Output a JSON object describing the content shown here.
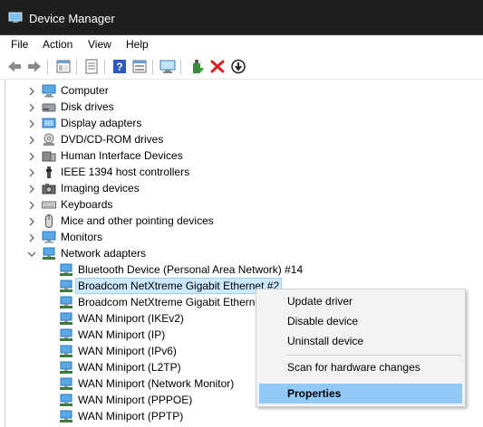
{
  "window": {
    "title": "Device Manager"
  },
  "menu": [
    "File",
    "Action",
    "View",
    "Help"
  ],
  "toolbar": {
    "buttons": [
      "back-icon",
      "forward-icon",
      "show-hide-tree-icon",
      "properties-icon",
      "help-icon",
      "view-icon",
      "scan-hardware-icon",
      "enable-device-icon",
      "uninstall-icon",
      "update-driver-icon"
    ]
  },
  "tree": {
    "categories": [
      {
        "label": "Computer",
        "icon": "computer-icon",
        "expanded": false
      },
      {
        "label": "Disk drives",
        "icon": "disk-drive-icon",
        "expanded": false
      },
      {
        "label": "Display adapters",
        "icon": "display-adapter-icon",
        "expanded": false
      },
      {
        "label": "DVD/CD-ROM drives",
        "icon": "dvd-drive-icon",
        "expanded": false
      },
      {
        "label": "Human Interface Devices",
        "icon": "hid-icon",
        "expanded": false
      },
      {
        "label": "IEEE 1394 host controllers",
        "icon": "ieee1394-icon",
        "expanded": false
      },
      {
        "label": "Imaging devices",
        "icon": "camera-icon",
        "expanded": false
      },
      {
        "label": "Keyboards",
        "icon": "keyboard-icon",
        "expanded": false
      },
      {
        "label": "Mice and other pointing devices",
        "icon": "mouse-icon",
        "expanded": false
      },
      {
        "label": "Monitors",
        "icon": "monitor-icon",
        "expanded": false
      },
      {
        "label": "Network adapters",
        "icon": "network-adapter-icon",
        "expanded": true
      }
    ],
    "network_children": [
      {
        "label": "Bluetooth Device (Personal Area Network) #14",
        "selected": false
      },
      {
        "label": "Broadcom NetXtreme Gigabit Ethernet #2",
        "selected": true
      },
      {
        "label": "Broadcom NetXtreme Gigabit Ethernet",
        "selected": false
      },
      {
        "label": "WAN Miniport (IKEv2)",
        "selected": false
      },
      {
        "label": "WAN Miniport (IP)",
        "selected": false
      },
      {
        "label": "WAN Miniport (IPv6)",
        "selected": false
      },
      {
        "label": "WAN Miniport (L2TP)",
        "selected": false
      },
      {
        "label": "WAN Miniport (Network Monitor)",
        "selected": false
      },
      {
        "label": "WAN Miniport (PPPOE)",
        "selected": false
      },
      {
        "label": "WAN Miniport (PPTP)",
        "selected": false
      }
    ]
  },
  "context_menu": {
    "items": [
      {
        "label": "Update driver",
        "highlighted": false
      },
      {
        "label": "Disable device",
        "highlighted": false
      },
      {
        "label": "Uninstall device",
        "highlighted": false
      },
      {
        "label": "Scan for hardware changes",
        "highlighted": false
      },
      {
        "label": "Properties",
        "highlighted": true
      }
    ]
  },
  "colors": {
    "titlebar": "#1f1f1f",
    "selection_bg": "#cce8ff",
    "selection_border": "#99d1ff",
    "menu_highlight": "#91c9f7",
    "delete_red": "#d41f1f"
  }
}
